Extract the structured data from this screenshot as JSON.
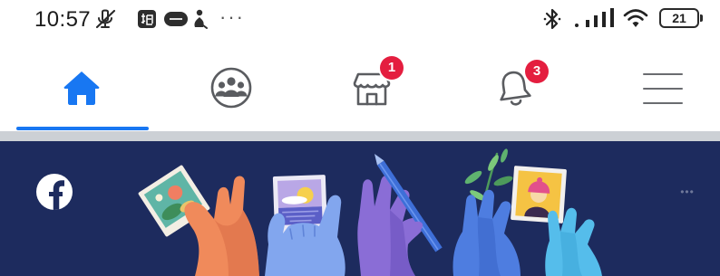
{
  "status_bar": {
    "time": "10:57",
    "overflow_indicator": "···",
    "battery_level": "21",
    "left_icons": [
      "muted-icon",
      "map-app-icon",
      "app-notification-icon",
      "person-icon"
    ],
    "right_icons": [
      "bluetooth-icon",
      "signal-icon",
      "wifi-icon",
      "battery-icon"
    ]
  },
  "nav": {
    "tabs": [
      {
        "icon": "home-icon",
        "active": true
      },
      {
        "icon": "groups-icon",
        "active": false
      },
      {
        "icon": "marketplace-icon",
        "active": false,
        "badge": "1"
      },
      {
        "icon": "bell-icon",
        "active": false,
        "badge": "3"
      },
      {
        "icon": "menu-icon",
        "active": false
      }
    ]
  },
  "banner": {
    "logo_icon": "facebook-logo-icon",
    "more_label": "•••"
  },
  "colors": {
    "accent": "#1877F2",
    "badge": "#E41E3F",
    "icon": "#5A5C60",
    "banner_background": "#1D2B5E",
    "divider": "#CCD0D5"
  }
}
